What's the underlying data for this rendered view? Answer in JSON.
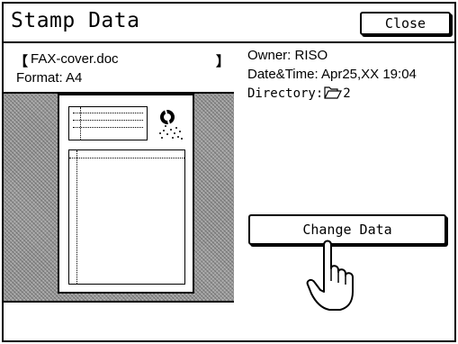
{
  "window": {
    "title": "Stamp Data",
    "close_label": "Close"
  },
  "file": {
    "open_bracket": "【",
    "name": "FAX-cover.doc",
    "close_bracket": "】",
    "format": "Format: A4"
  },
  "details": {
    "owner": "Owner: RISO",
    "datetime": "Date&Time: Apr25,XX   19:04",
    "directory_label": "Directory:",
    "directory_value": "2"
  },
  "actions": {
    "change_data_label": "Change Data"
  },
  "icons": {
    "folder": "folder-icon",
    "pointer": "hand-pointer-icon",
    "logo": "stamp-logo-icon"
  }
}
